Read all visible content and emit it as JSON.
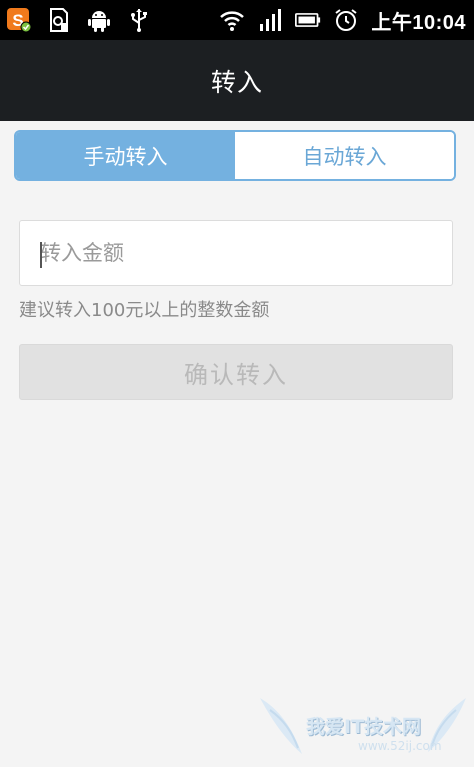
{
  "status_bar": {
    "time": "上午10:04",
    "left_icons": [
      "sogou-input-icon",
      "sd-card-icon",
      "android-debug-icon",
      "usb-icon"
    ],
    "right_icons": [
      "wifi-icon",
      "signal-icon",
      "battery-icon",
      "alarm-icon"
    ]
  },
  "header": {
    "title": "转入"
  },
  "tabs": [
    {
      "label": "手动转入",
      "active": true
    },
    {
      "label": "自动转入",
      "active": false
    }
  ],
  "amount_input": {
    "placeholder": "转入金额",
    "value": ""
  },
  "hint": "建议转入100元以上的整数金额",
  "confirm_button": {
    "label": "确认转入",
    "enabled": false
  },
  "watermark": {
    "title": "我爱IT技术网",
    "url": "www.52ij.com"
  },
  "colors": {
    "accent": "#74b1e0",
    "title_bar": "#1c1f22",
    "background": "#f4f4f4"
  }
}
